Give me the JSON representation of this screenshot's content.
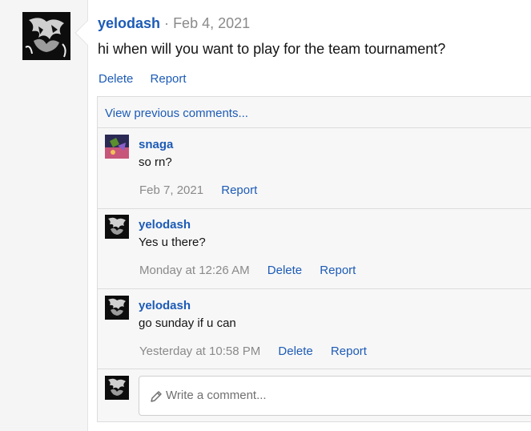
{
  "post": {
    "author": "yelodash",
    "separator": "·",
    "date": "Feb 4, 2021",
    "text": "hi when will you want to play for the team tournament?",
    "actions": {
      "delete": "Delete",
      "report": "Report"
    }
  },
  "comments": {
    "view_previous": "View previous comments...",
    "items": [
      {
        "author": "snaga",
        "text": "so rn?",
        "time": "Feb 7, 2021",
        "report": "Report"
      },
      {
        "author": "yelodash",
        "text": "Yes u there?",
        "time": "Monday at 12:26 AM",
        "delete": "Delete",
        "report": "Report"
      },
      {
        "author": "yelodash",
        "text": "go sunday if u can",
        "time": "Yesterday at 10:58 PM",
        "delete": "Delete",
        "report": "Report"
      }
    ],
    "reply": {
      "placeholder": "Write a comment..."
    }
  },
  "colors": {
    "link": "#1d5bb6",
    "muted": "#8a8a8a",
    "text": "#141414"
  },
  "icons": {
    "reply_icon": "pencil-icon"
  }
}
